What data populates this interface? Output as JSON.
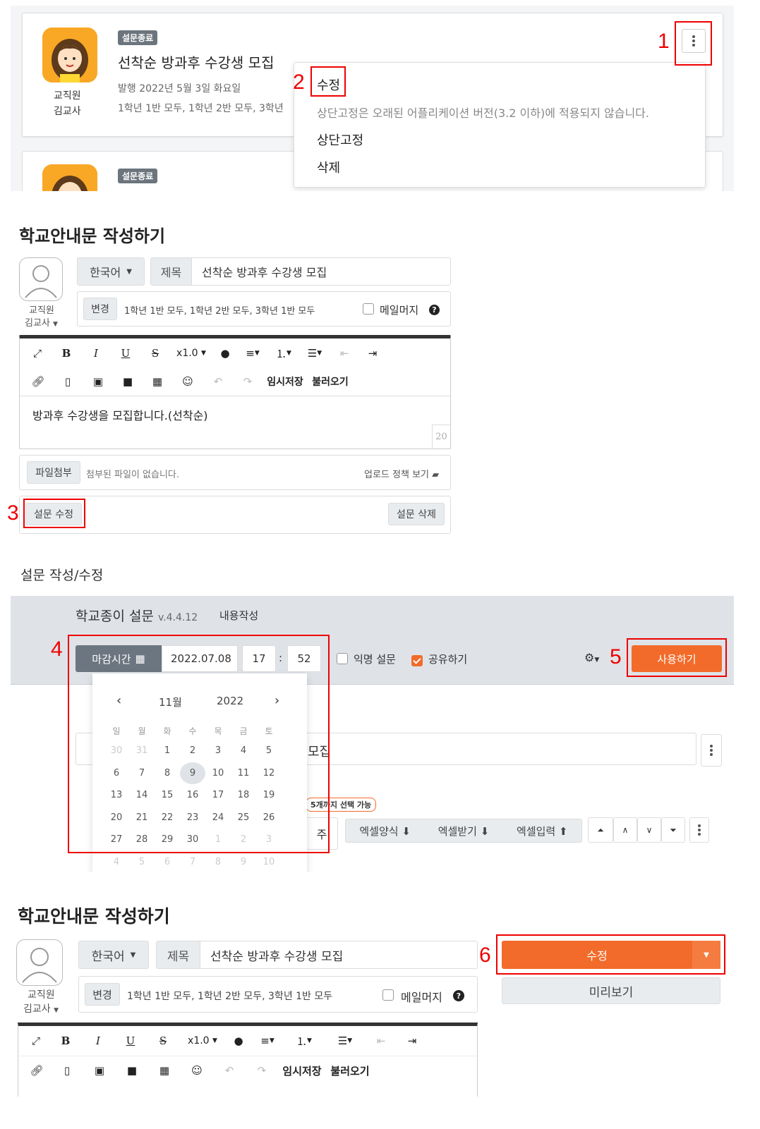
{
  "steps": [
    "1",
    "2",
    "3",
    "4",
    "5",
    "6"
  ],
  "colors": {
    "accent": "#f26b2a",
    "annotation": "#e00000",
    "badge": "#6c757d",
    "avatar": "#f9a825"
  },
  "panel1": {
    "card": {
      "badge": "설문종료",
      "title": "선착순 방과후 수강생 모집",
      "author_role": "교직원",
      "author_name": "김교사",
      "published": "발행 2022년 5월 3일 화요일",
      "targets": "1학년 1반 모두, 1학년 2반 모두, 3학년"
    },
    "card2": {
      "badge": "설문종료"
    },
    "menu": {
      "edit": "수정",
      "pin_note": "상단고정은 오래된 어플리케이션 버전(3.2 이하)에 적용되지 않습니다.",
      "pin": "상단고정",
      "delete": "삭제"
    },
    "more_icon": "vertical-dots-icon"
  },
  "panel2": {
    "heading": "학교안내문 작성하기",
    "author_role": "교직원",
    "author_name": "김교사",
    "language": "한국어",
    "title_label": "제목",
    "title_value": "선착순 방과후 수강생 모집",
    "change_label": "변경",
    "targets": "1학년 1반 모두, 1학년 2반 모두, 3학년 1반 모두",
    "mail_merge": "메일머지",
    "toolbar": {
      "zoom": "x1.0",
      "temp_save": "임시저장",
      "load": "불러오기"
    },
    "body_text": "방과후 수강생을 모집합니다.(선착순)",
    "char_count": "20",
    "attach_label": "파일첨부",
    "attach_empty": "첨부된 파일이 없습니다.",
    "upload_policy": "업로드 정책 보기",
    "survey_edit": "설문 수정",
    "survey_delete": "설문 삭제"
  },
  "panel3": {
    "heading": "설문 작성/수정",
    "app_name": "학교종이 설문",
    "version": "v.4.4.12",
    "tab": "내용작성",
    "deadline_label": "마감시간",
    "date": "2022.07.08",
    "hour": "17",
    "minute": "52",
    "anonymous": "익명 설문",
    "share": "공유하기",
    "use_button": "사용하기",
    "calendar": {
      "month": "11월",
      "year": "2022",
      "weekdays": [
        "일",
        "월",
        "화",
        "수",
        "목",
        "금",
        "토"
      ],
      "weeks": [
        [
          "30",
          "31",
          "1",
          "2",
          "3",
          "4",
          "5"
        ],
        [
          "6",
          "7",
          "8",
          "9",
          "10",
          "11",
          "12"
        ],
        [
          "13",
          "14",
          "15",
          "16",
          "17",
          "18",
          "19"
        ],
        [
          "20",
          "21",
          "22",
          "23",
          "24",
          "25",
          "26"
        ],
        [
          "27",
          "28",
          "29",
          "30",
          "1",
          "2",
          "3"
        ],
        [
          "4",
          "5",
          "6",
          "7",
          "8",
          "9",
          "10"
        ]
      ],
      "selected": "9"
    },
    "behind_text": "모집",
    "limit_tag": "5개까지 선택 가능",
    "behind_left": "주",
    "excel_form": "엑셀양식",
    "excel_download": "엑셀받기",
    "excel_upload": "엑셀입력"
  },
  "panel4": {
    "heading": "학교안내문 작성하기",
    "author_role": "교직원",
    "author_name": "김교사",
    "language": "한국어",
    "title_label": "제목",
    "title_value": "선착순 방과후 수강생 모집",
    "change_label": "변경",
    "targets": "1학년 1반 모두, 1학년 2반 모두, 3학년 1반 모두",
    "mail_merge": "메일머지",
    "submit": "수정",
    "preview": "미리보기",
    "toolbar": {
      "zoom": "x1.0",
      "temp_save": "임시저장",
      "load": "불러오기"
    }
  }
}
